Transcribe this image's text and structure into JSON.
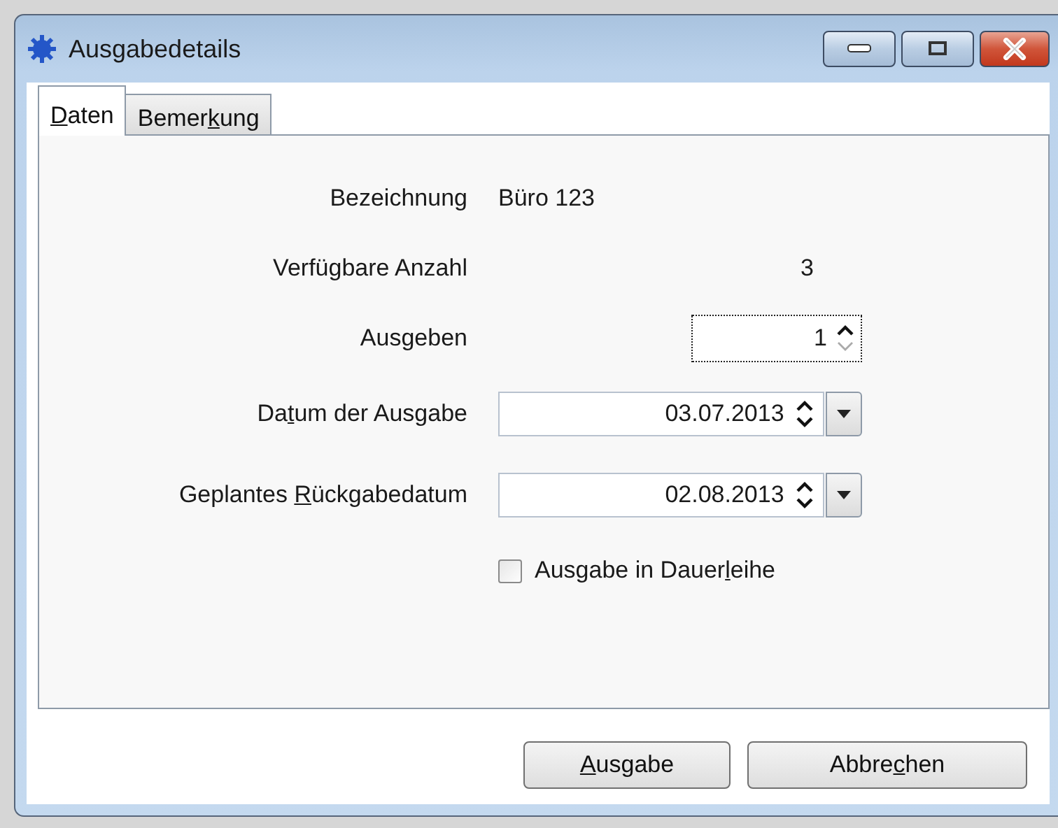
{
  "window": {
    "title": "Ausgabedetails"
  },
  "tabs": [
    {
      "label": {
        "key": "D",
        "after": "aten"
      },
      "selected": true
    },
    {
      "label": {
        "before": "Bemer",
        "key": "k",
        "after": "ung"
      },
      "selected": false
    }
  ],
  "fields": [
    {
      "kind": "text",
      "label": {
        "before": "Bezeichnung"
      },
      "value": "Büro 123"
    },
    {
      "kind": "number",
      "label": {
        "before": "Verfügbare Anzahl"
      },
      "value": "3"
    },
    {
      "kind": "spin",
      "label": {
        "before": "Aus",
        "key": "g",
        "after": "eben"
      },
      "value": "1",
      "focused": true,
      "down_disabled": true
    },
    {
      "kind": "date",
      "label": {
        "before": "Da",
        "key": "t",
        "after": "um der Ausgabe"
      },
      "value": "03.07.2013"
    },
    {
      "kind": "date",
      "label": {
        "before": "Geplantes ",
        "key": "R",
        "after": "ückgabedatum"
      },
      "value": "02.08.2013"
    },
    {
      "kind": "checkbox",
      "label": {
        "before": "Ausgabe in Dauer",
        "key": "l",
        "after": "eihe"
      },
      "checked": false
    }
  ],
  "buttons": [
    {
      "label": {
        "key": "A",
        "after": "usgabe"
      }
    },
    {
      "label": {
        "before": "Abbre",
        "key": "c",
        "after": "hen"
      }
    }
  ]
}
